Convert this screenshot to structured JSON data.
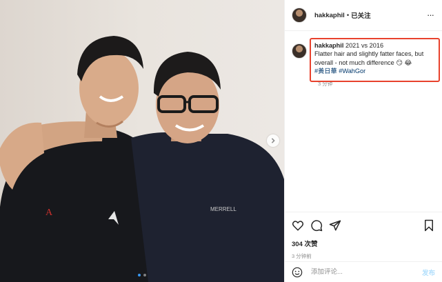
{
  "post": {
    "username": "hakkaphil",
    "separator": "•",
    "follow_status": "已关注",
    "more_icon": "more-horizontal-icon"
  },
  "media": {
    "carousel_dots": 2,
    "active_dot": 0,
    "next_icon": "chevron-right-icon",
    "shirt_text_left": "A",
    "shirt_text_right": "MERRELL"
  },
  "caption": {
    "username": "hakkaphil",
    "title": "2021 vs 2016",
    "text": "Flatter hair and slightly fatter faces, but overall - not much difference",
    "emojis": "😏 😂",
    "hashtags": [
      "#黃日華",
      "#WahGor"
    ],
    "time": "3 分钟"
  },
  "actions": {
    "like_icon": "heart-icon",
    "comment_icon": "comment-icon",
    "share_icon": "share-icon",
    "save_icon": "bookmark-icon"
  },
  "likes_label": "304 次赞",
  "post_time": "3 分钟前",
  "comment_box": {
    "placeholder": "添加评论...",
    "publish_label": "发布",
    "emoji_icon": "smiley-icon"
  },
  "colors": {
    "highlight_border": "#e8412c",
    "hashtag": "#00376b",
    "publish_disabled": "#b2dffc",
    "active_dot": "#3897f0"
  }
}
